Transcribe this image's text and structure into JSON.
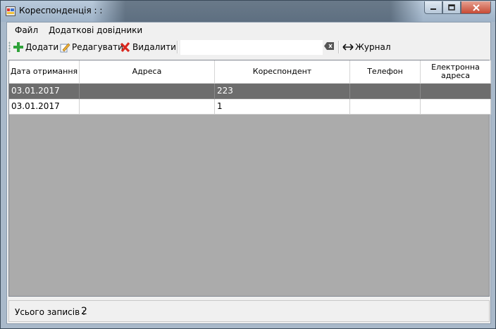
{
  "window": {
    "title": "Кореспонденція :  :",
    "controls": {
      "minimize": "minimize",
      "maximize": "maximize",
      "close": "close"
    }
  },
  "menu": {
    "file": "Файл",
    "references": "Додаткові довідники"
  },
  "toolbar": {
    "add_label": "Додати",
    "edit_label": "Редагувати",
    "delete_label": "Видалити",
    "search_value": "",
    "journal_label": "Журнал",
    "icons": {
      "add": "plus-icon",
      "edit": "pencil-icon",
      "delete": "red-x-icon",
      "clear": "clear-input-icon",
      "journal": "double-arrow-icon"
    },
    "colors": {
      "add": "#2fa23a",
      "delete": "#d9281f"
    }
  },
  "grid": {
    "columns": [
      {
        "label": "Дата отримання"
      },
      {
        "label": "Адреса"
      },
      {
        "label": "Кореспондент"
      },
      {
        "label": "Телефон"
      },
      {
        "label": "Електронна адреса"
      }
    ],
    "rows": [
      {
        "date": "03.01.2017",
        "address": "",
        "correspondent": "223",
        "phone": "",
        "email": "",
        "selected": true
      },
      {
        "date": "03.01.2017",
        "address": "",
        "correspondent": "1",
        "phone": "",
        "email": "",
        "selected": false
      }
    ],
    "colors": {
      "selected_row": "#6d6d6d",
      "empty_area": "#ababab"
    }
  },
  "status": {
    "label": "Усього записів :",
    "count": "2"
  }
}
